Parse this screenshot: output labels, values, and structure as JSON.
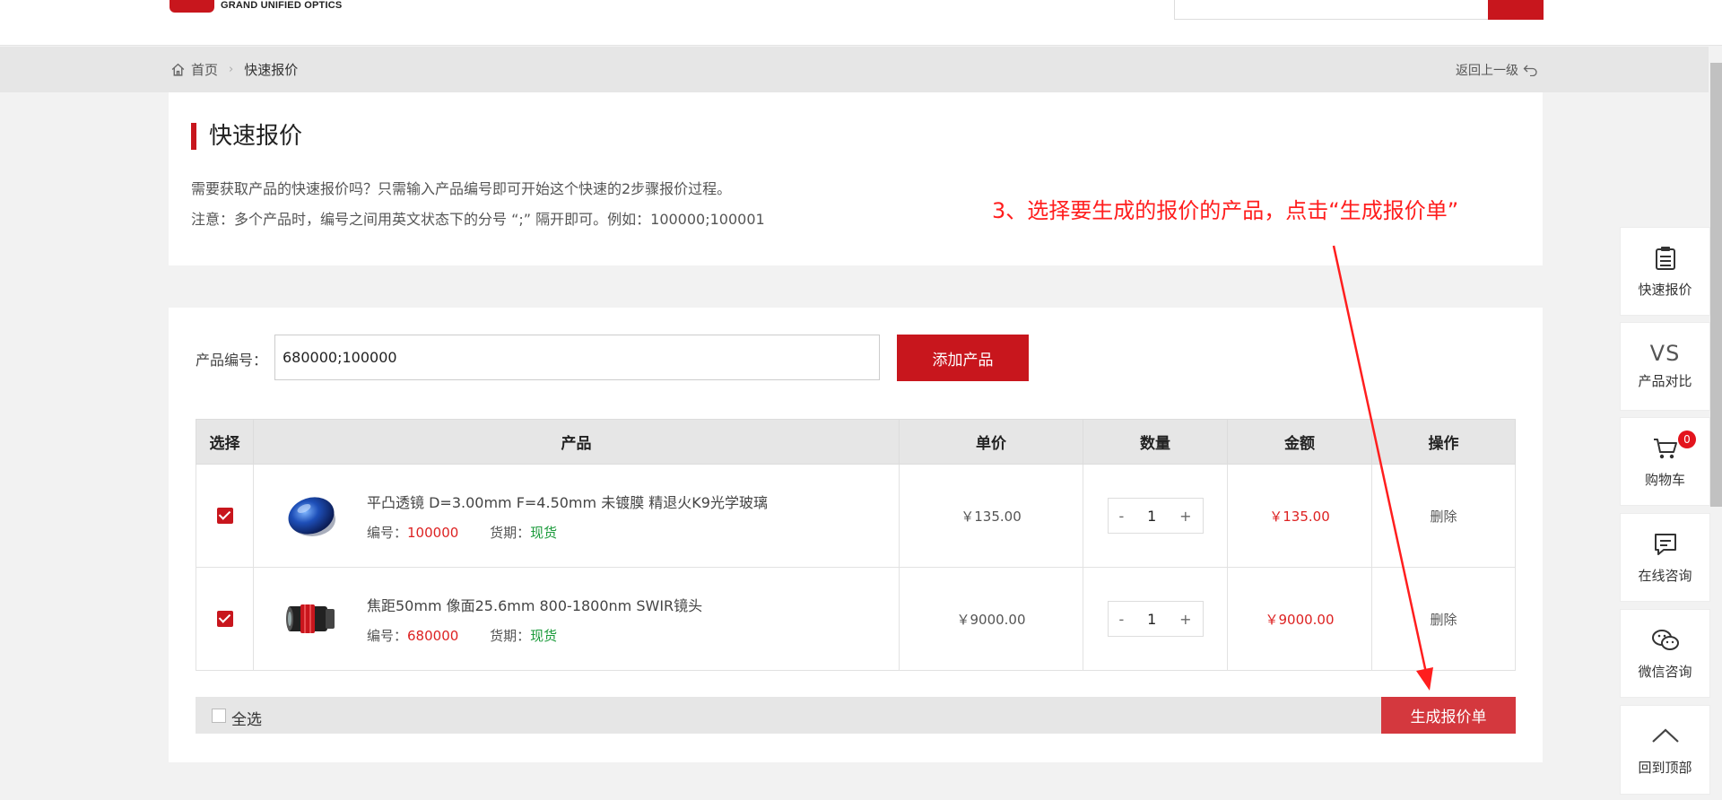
{
  "header": {
    "logo_text": "GRAND UNIFIED OPTICS"
  },
  "breadcrumb": {
    "home": "首页",
    "separator": "›",
    "current": "快速报价",
    "back": "返回上一级"
  },
  "intro": {
    "title": "快速报价",
    "line1": "需要获取产品的快速报价吗？只需输入产品编号即可开始这个快速的2步骤报价过程。",
    "line2": "注意：多个产品时，编号之间用英文状态下的分号 “;” 隔开即可。例如：100000;100001"
  },
  "annotation": "3、选择要生成的报价的产品，点击“生成报价单”",
  "form": {
    "label": "产品编号：",
    "value": "680000;100000",
    "add_label": "添加产品"
  },
  "table": {
    "headers": [
      "选择",
      "产品",
      "单价",
      "数量",
      "金额",
      "操作"
    ],
    "code_label": "编号：",
    "stock_label": "货期：",
    "rows": [
      {
        "name": "平凸透镜 D=3.00mm F=4.50mm 未镀膜 精退火K9光学玻璃",
        "code": "100000",
        "stock": "现货",
        "price": "￥135.00",
        "qty": "1",
        "amount": "￥135.00",
        "action": "删除",
        "minus": "-",
        "plus": "+"
      },
      {
        "name": "焦距50mm 像面25.6mm 800-1800nm SWIR镜头",
        "code": "680000",
        "stock": "现货",
        "price": "￥9000.00",
        "qty": "1",
        "amount": "￥9000.00",
        "action": "删除",
        "minus": "-",
        "plus": "+"
      }
    ]
  },
  "footer": {
    "select_all": "全选",
    "generate": "生成报价单"
  },
  "side": [
    {
      "label": "快速报价",
      "icon": "clipboard-icon"
    },
    {
      "label": "产品对比",
      "icon": "vs-icon",
      "icon_text": "VS"
    },
    {
      "label": "购物车",
      "icon": "cart-icon",
      "badge": "0"
    },
    {
      "label": "在线咨询",
      "icon": "chat-icon"
    },
    {
      "label": "微信咨询",
      "icon": "wechat-icon"
    },
    {
      "label": "回到顶部",
      "icon": "chevron-up-icon"
    }
  ],
  "colors": {
    "brand": "#c8161d",
    "annotation": "#ff1e1e",
    "stock": "#1a9a3a"
  }
}
